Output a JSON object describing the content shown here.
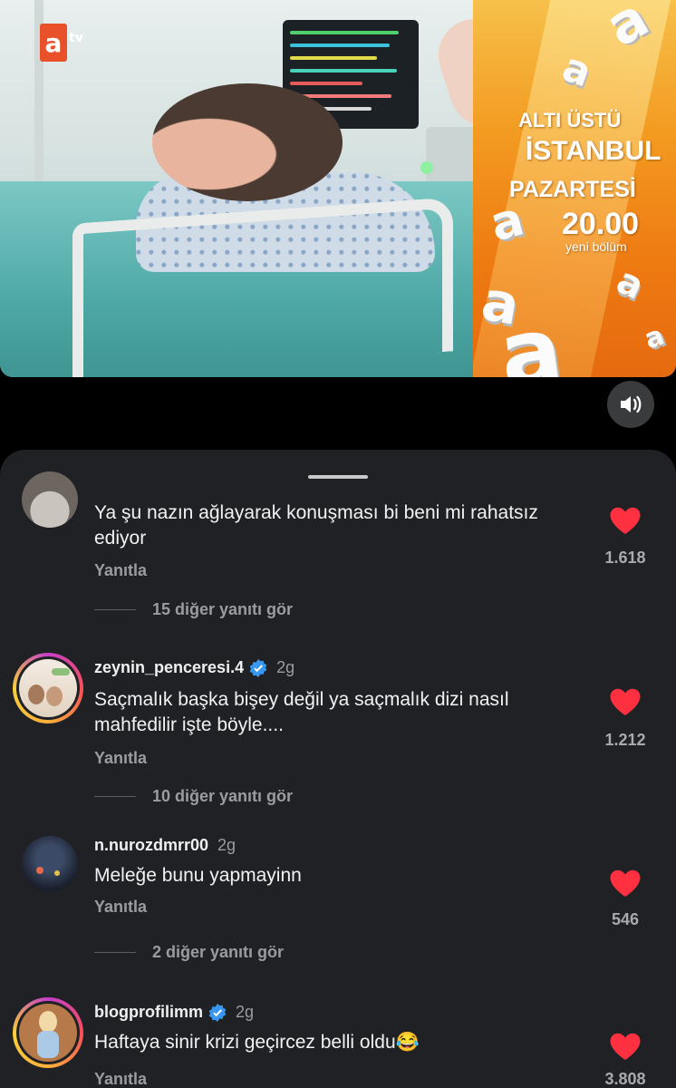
{
  "video": {
    "channel_logo": "a",
    "channel_suffix": "tv",
    "promo": {
      "show_title_line1": "ALTI ÜSTÜ",
      "show_title_line2": "İSTANBUL",
      "day": "PAZARTESİ",
      "time": "20.00",
      "episode": "yeni bölüm"
    },
    "sound_icon": "speaker-icon"
  },
  "comments": [
    {
      "username": "",
      "time": "",
      "verified": false,
      "text": "Ya şu nazın ağlayarak konuşması bi beni mi rahatsız ediyor",
      "reply_label": "Yanıtla",
      "likes": "1.618",
      "more_replies": "15 diğer yanıtı gör"
    },
    {
      "username": "zeynin_penceresi.4",
      "time": "2g",
      "verified": true,
      "text": "Saçmalık başka bişey değil ya saçmalık dizi nasıl mahfedilir işte böyle....",
      "reply_label": "Yanıtla",
      "likes": "1.212",
      "more_replies": "10 diğer yanıtı gör"
    },
    {
      "username": "n.nurozdmrr00",
      "time": "2g",
      "verified": false,
      "text": "Meleğe bunu yapmayinn",
      "reply_label": "Yanıtla",
      "likes": "546",
      "more_replies": "2 diğer yanıtı gör"
    },
    {
      "username": "blogprofilimm",
      "time": "2g",
      "verified": true,
      "text": "Haftaya sinir krizi geçircez belli oldu😂",
      "reply_label": "Yanıtla",
      "likes": "3.808"
    }
  ],
  "colors": {
    "sheet_background": "#1f2125",
    "heart": "#ff3040",
    "verified": "#3897f0"
  }
}
